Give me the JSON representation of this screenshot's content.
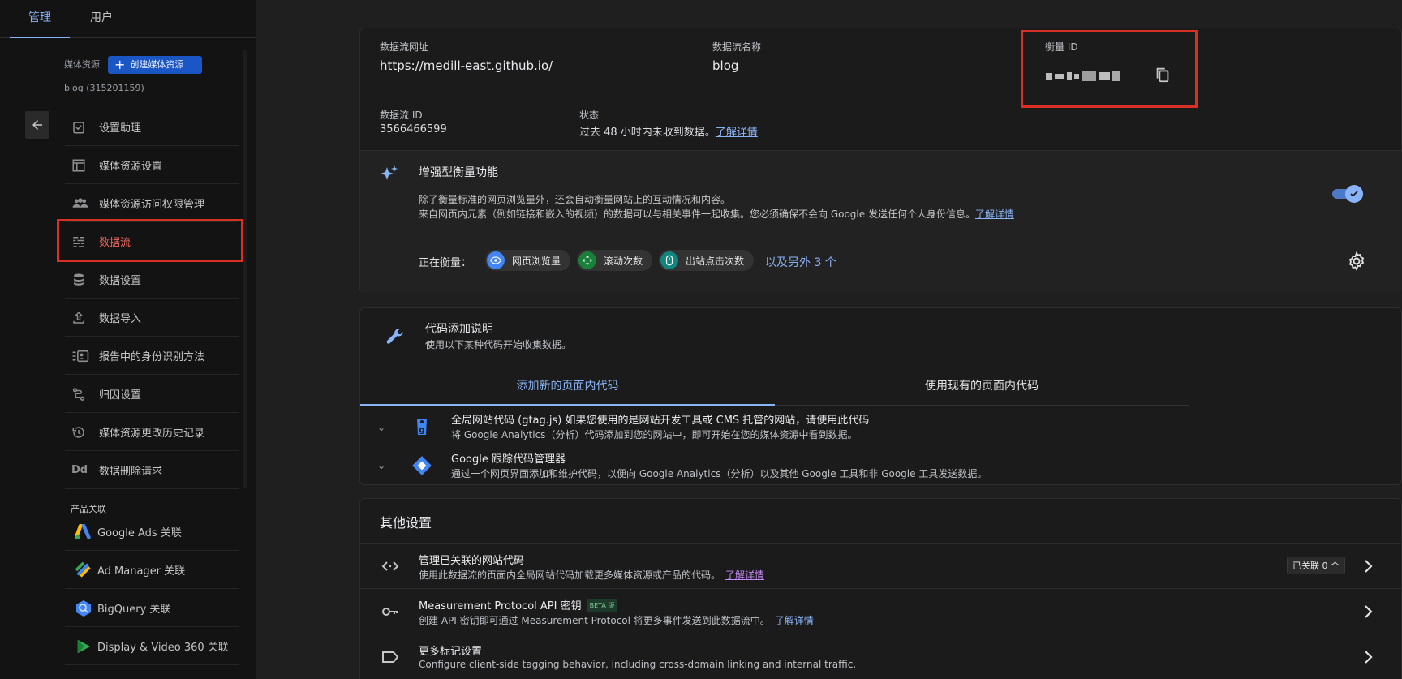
{
  "topnav": {
    "tabs": [
      "管理",
      "用户"
    ]
  },
  "sidebar": {
    "asset_label": "媒体资源",
    "create_asset_label": "创建媒体资源",
    "asset_name": "blog (315201159)",
    "items": [
      {
        "label": "设置助理",
        "icon": "checklist-icon"
      },
      {
        "label": "媒体资源设置",
        "icon": "layout-icon"
      },
      {
        "label": "媒体资源访问权限管理",
        "icon": "people-icon"
      },
      {
        "label": "数据流",
        "icon": "data-stream-icon",
        "active": true
      },
      {
        "label": "数据设置",
        "icon": "database-icon"
      },
      {
        "label": "数据导入",
        "icon": "upload-icon"
      },
      {
        "label": "报告中的身份识别方法",
        "icon": "identity-icon"
      },
      {
        "label": "归因设置",
        "icon": "attribution-icon"
      },
      {
        "label": "媒体资源更改历史记录",
        "icon": "history-icon"
      },
      {
        "label": "数据删除请求",
        "icon": "dd-icon",
        "icon_text": "Dd"
      }
    ],
    "products_title": "产品关联",
    "products": [
      {
        "label": "Google Ads 关联",
        "icon": "google-ads-icon"
      },
      {
        "label": "Ad Manager 关联",
        "icon": "ad-manager-icon"
      },
      {
        "label": "BigQuery 关联",
        "icon": "bigquery-icon"
      },
      {
        "label": "Display & Video 360 关联",
        "icon": "dv360-icon"
      }
    ]
  },
  "stream": {
    "url_label": "数据流网址",
    "url_value": "https://medill-east.github.io/",
    "name_label": "数据流名称",
    "name_value": "blog",
    "mid_label": "衡量 ID",
    "id_label": "数据流 ID",
    "id_value": "3566466599",
    "status_label": "状态",
    "status_value": "过去 48 小时内未收到数据。",
    "status_link": "了解详情"
  },
  "enhanced": {
    "title": "增强型衡量功能",
    "desc1": "除了衡量标准的网页浏览量外，还会自动衡量网站上的互动情况和内容。",
    "desc2": "来自网页内元素（例如链接和嵌入的视频）的数据可以与相关事件一起收集。您必须确保不会向 Google 发送任何个人身份信息。",
    "desc2_link": "了解详情",
    "measuring_label": "正在衡量：",
    "chips": [
      "网页浏览量",
      "滚动次数",
      "出站点击次数"
    ],
    "more": "以及另外 3 个",
    "enabled": true
  },
  "code": {
    "title": "代码添加说明",
    "subtitle": "使用以下某种代码开始收集数据。",
    "tabs": [
      "添加新的页面内代码",
      "使用现有的页面内代码"
    ],
    "rows": [
      {
        "title": "全局网站代码 (gtag.js) 如果您使用的是网站开发工具或 CMS 托管的网站，请使用此代码",
        "sub": "将 Google Analytics（分析）代码添加到您的网站中，即可开始在您的媒体资源中看到数据。"
      },
      {
        "title": "Google 跟踪代码管理器",
        "sub": "通过一个网页界面添加和维护代码，以便向 Google Analytics（分析）以及其他 Google 工具和非 Google 工具发送数据。"
      }
    ]
  },
  "other": {
    "title": "其他设置",
    "rows": [
      {
        "title": "管理已关联的网站代码",
        "sub": "使用此数据流的页面内全局网站代码加载更多媒体资源或产品的代码。",
        "link": "了解详情",
        "badge": "已关联 0 个"
      },
      {
        "title": "Measurement Protocol API 密钥",
        "beta": "BETA 版",
        "sub": "创建 API 密钥即可通过 Measurement Protocol 将更多事件发送到此数据流中。",
        "link": "了解详情"
      },
      {
        "title": "更多标记设置",
        "sub": "Configure client-side tagging behavior, including cross-domain linking and internal traffic."
      }
    ]
  },
  "colors": {
    "accent": "#8ab4f8",
    "highlight": "#d93025",
    "active_nav": "#ee675c"
  }
}
